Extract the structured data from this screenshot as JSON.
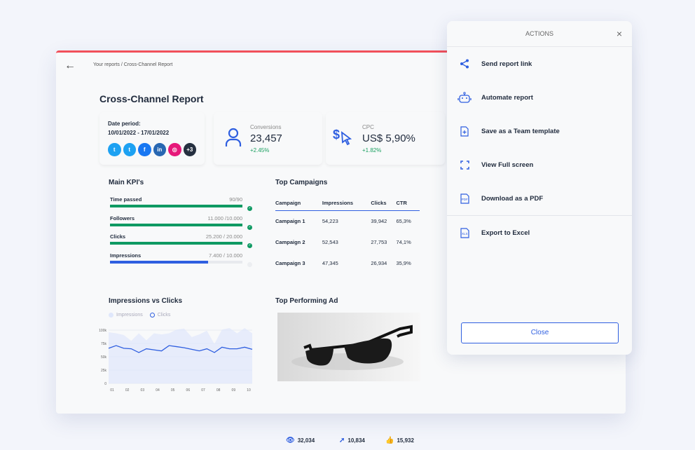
{
  "breadcrumb": "Your reports / Cross-Channel Report",
  "back_icon": "←",
  "title": "Cross-Channel Report",
  "date_period": {
    "label": "Date period:",
    "value": "10/01/2022 - 17/01/2022",
    "channels": [
      {
        "name": "twitter",
        "glyph": "t",
        "color": "#1da1f2"
      },
      {
        "name": "twitter-ads",
        "glyph": "t",
        "color": "#1da1f2"
      },
      {
        "name": "facebook-ads",
        "glyph": "f",
        "color": "#1877f2"
      },
      {
        "name": "linkedin-ads",
        "glyph": "in",
        "color": "#2867b2"
      },
      {
        "name": "instagram",
        "glyph": "◎",
        "color": "#e6197a"
      }
    ],
    "more": "+3"
  },
  "kpis": [
    {
      "label": "Conversions",
      "value": "23,457",
      "change": "+2.45%",
      "icon": "user-icon"
    },
    {
      "label": "CPC",
      "value": "US$ 5,90%",
      "change": "+1.82%",
      "icon": "dollar-cursor-icon"
    }
  ],
  "main_kpis": {
    "title": "Main KPI's",
    "items": [
      {
        "label": "Time passed",
        "value": "90/90",
        "progress": 100,
        "done": true
      },
      {
        "label": "Followers",
        "value": "11.000 /10.000",
        "progress": 100,
        "done": true
      },
      {
        "label": "Clicks",
        "value": "25.200 / 20.000",
        "progress": 100,
        "done": true
      },
      {
        "label": "Impressions",
        "value": "7.400 / 10.000",
        "progress": 74,
        "done": false
      }
    ]
  },
  "campaigns": {
    "title": "Top Campaigns",
    "headers": [
      "Campaign",
      "Impressions",
      "Clicks",
      "CTR"
    ],
    "rows": [
      [
        "Campaign 1",
        "54,223",
        "39,942",
        "65,3%"
      ],
      [
        "Campaign 2",
        "52,543",
        "27,753",
        "74,1%"
      ],
      [
        "Campaign 3",
        "47,345",
        "26,934",
        "35,9%"
      ]
    ]
  },
  "chart_data": {
    "type": "area",
    "title": "Impressions vs Clicks",
    "xlabel": "",
    "ylabel": "",
    "x_ticks": [
      "01",
      "02",
      "03",
      "04",
      "05",
      "06",
      "07",
      "08",
      "09",
      "10"
    ],
    "y_ticks": [
      "0",
      "25k",
      "50k",
      "75k",
      "100k"
    ],
    "ylim": [
      0,
      100000
    ],
    "grid": true,
    "legend": "top-left",
    "series": [
      {
        "name": "Impressions",
        "color": "#dfe7fb",
        "values": [
          96000,
          94000,
          91000,
          80000,
          94000,
          81000,
          94000,
          92000,
          94000,
          101000,
          103000,
          87000,
          92000,
          99000,
          74000,
          101000,
          104000,
          94000,
          104000,
          94000
        ]
      },
      {
        "name": "Clicks",
        "color": "#2f5fe0",
        "values": [
          66000,
          71000,
          66000,
          65000,
          58000,
          65000,
          63000,
          61000,
          71000,
          69000,
          67000,
          64000,
          61000,
          65000,
          58000,
          68000,
          65000,
          65000,
          68000,
          64000
        ]
      }
    ]
  },
  "top_ad": {
    "title": "Top Performing Ad",
    "views": "32,034",
    "clicks": "10,834",
    "likes": "15,932"
  },
  "actions": {
    "title": "ACTIONS",
    "close_icon": "×",
    "items": [
      {
        "label": "Send report link",
        "icon": "share-icon"
      },
      {
        "label": "Automate report",
        "icon": "robot-icon"
      },
      {
        "label": "Save as a Team template",
        "icon": "file-plus-icon"
      },
      {
        "label": "View Full screen",
        "icon": "fullscreen-icon"
      },
      {
        "label": "Download as a PDF",
        "icon": "pdf-icon"
      },
      {
        "label": "Export to Excel",
        "icon": "xls-icon"
      }
    ],
    "close_label": "Close"
  },
  "colors": {
    "accent": "#2f5fe0",
    "success": "#0f9a63",
    "top_border": "#f1505a"
  }
}
